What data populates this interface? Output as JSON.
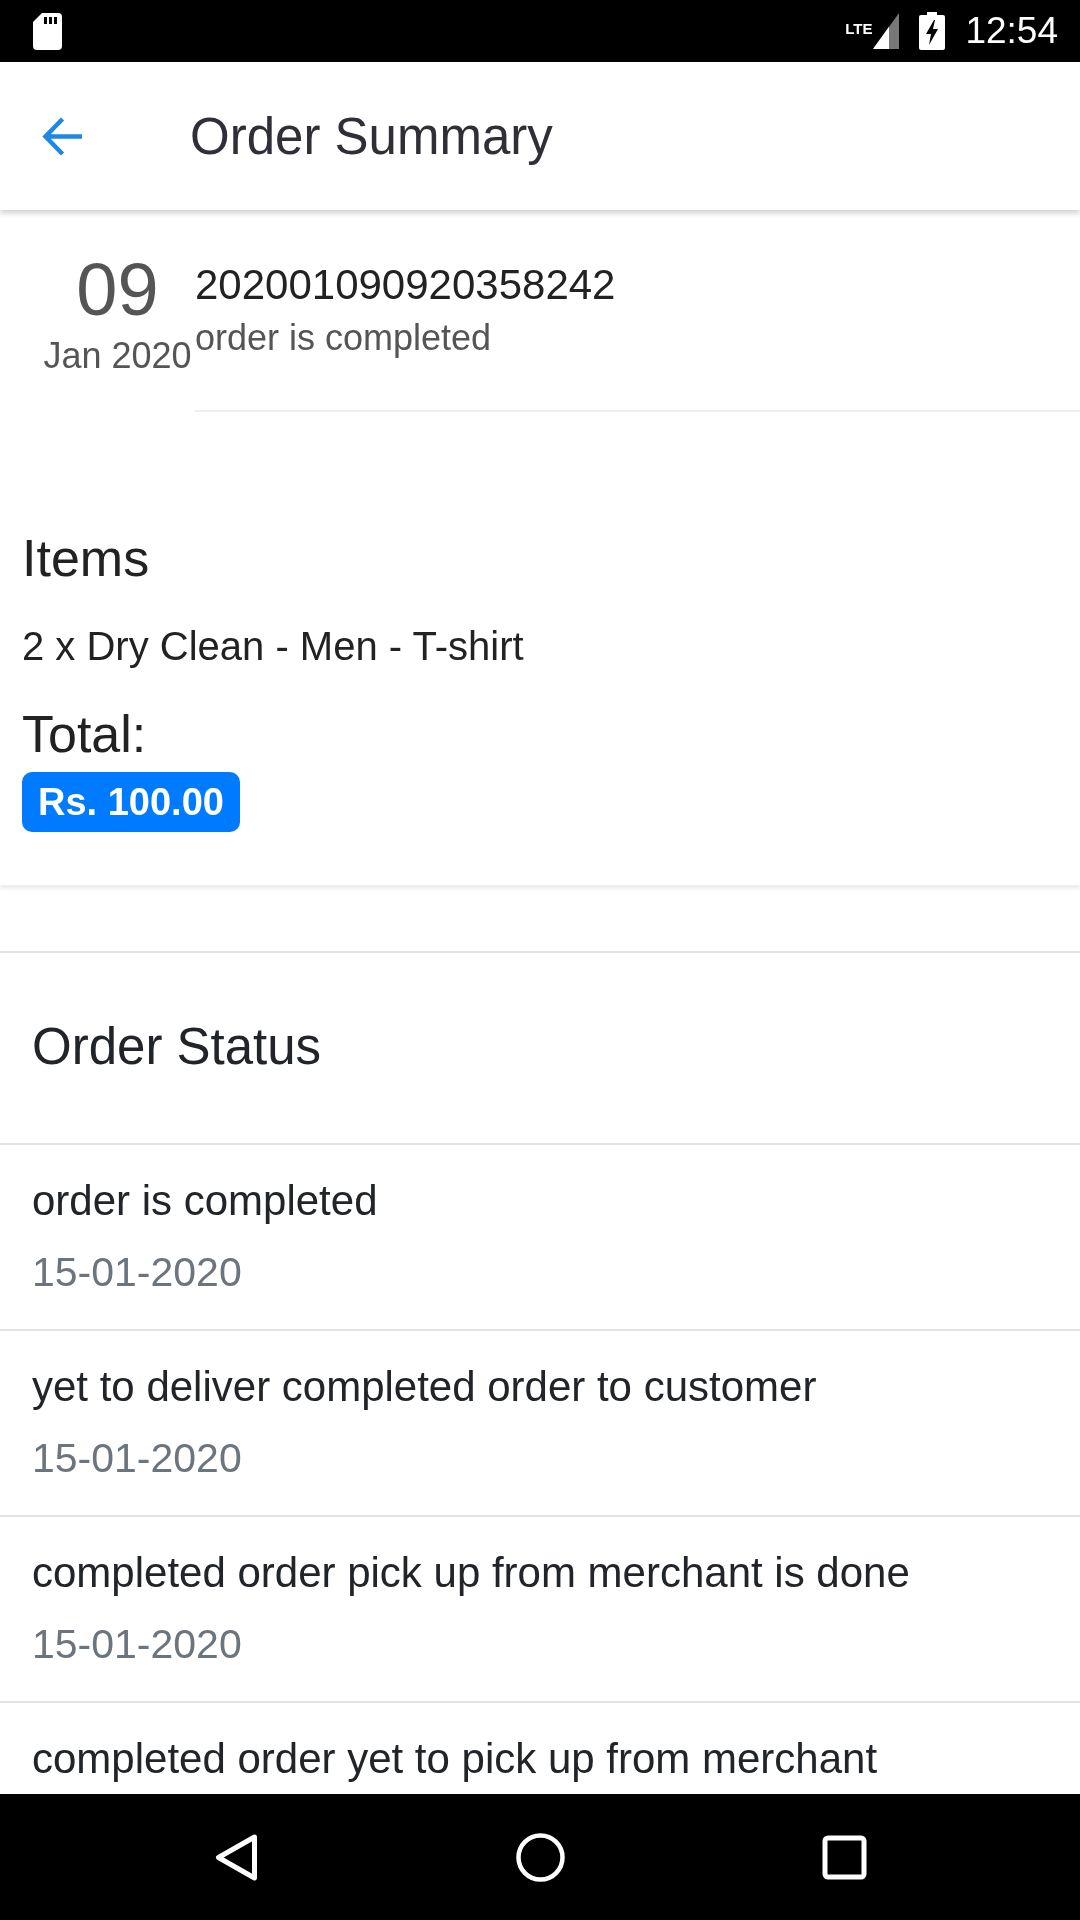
{
  "status_bar": {
    "network": "LTE",
    "time": "12:54"
  },
  "app_bar": {
    "title": "Order Summary"
  },
  "order": {
    "day": "09",
    "month_year": "Jan 2020",
    "number": "202001090920358242",
    "status": "order is completed"
  },
  "items_section": {
    "heading": "Items",
    "items": [
      "2 x Dry Clean - Men - T-shirt"
    ],
    "total_label": "Total:",
    "total": "Rs. 100.00"
  },
  "order_status": {
    "heading": "Order Status",
    "entries": [
      {
        "text": "order is completed",
        "date": "15-01-2020"
      },
      {
        "text": "yet to deliver completed order to customer",
        "date": "15-01-2020"
      },
      {
        "text": "completed order pick up from merchant is done",
        "date": "15-01-2020"
      },
      {
        "text": "completed order yet to pick up from merchant"
      }
    ]
  }
}
